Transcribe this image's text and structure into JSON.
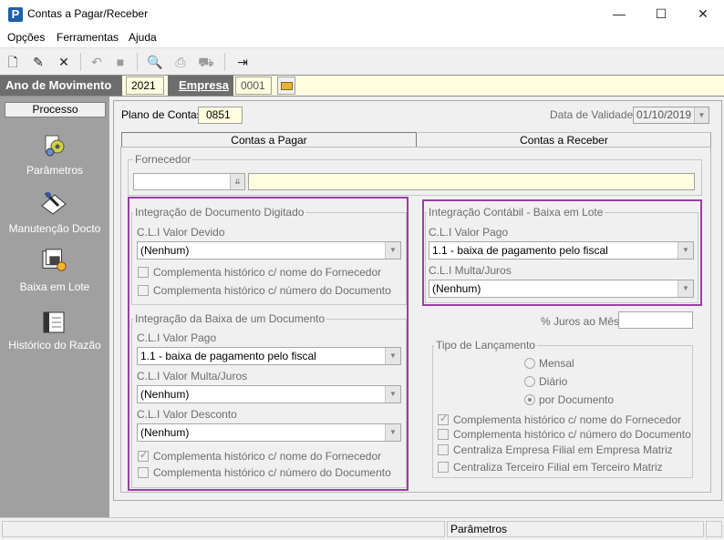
{
  "window": {
    "title": "Contas a Pagar/Receber",
    "app_icon_letter": "P",
    "minimize": "—",
    "maximize": "☐",
    "close": "✕"
  },
  "menu": [
    "Opções",
    "Ferramentas",
    "Ajuda"
  ],
  "toolbar": {
    "icons": [
      "new-document-icon",
      "edit-document-icon",
      "delete-icon",
      "undo-icon",
      "stop-icon",
      "print-preview-icon",
      "print-icon",
      "truck-icon",
      "exit-icon"
    ]
  },
  "yearbar": {
    "ano_label": "Ano de Movimento",
    "ano_value": "2021",
    "empresa_label": "Empresa",
    "empresa_value": "0001",
    "folder_icon": "folder-open-icon"
  },
  "sidebar": {
    "header": "Processo",
    "items": [
      {
        "label": "Parâmetros",
        "icon": "settings-gears-icon"
      },
      {
        "label": "Manutenção Docto",
        "icon": "document-edit-icon"
      },
      {
        "label": "Baixa em Lote",
        "icon": "batch-process-icon"
      },
      {
        "label": "Histórico do Razão",
        "icon": "ledger-book-icon"
      }
    ]
  },
  "main": {
    "plano_label": "Plano de Contas",
    "plano_value": "0851",
    "validade_label": "Data de Validade",
    "validade_value": "01/10/2019",
    "tabs": [
      "Contas a Pagar",
      "Contas a Receber"
    ],
    "fornecedor_title": "Fornecedor",
    "left": {
      "group1_title": "Integração de Documento Digitado",
      "cli_valor_devido_label": "C.L.I Valor Devido",
      "cli_valor_devido_value": "(Nenhum)",
      "chk1_label": "Complementa histórico c/ nome do Fornecedor",
      "chk2_label": "Complementa histórico c/ número do Documento",
      "group2_title": "Integração da Baixa de um Documento",
      "cli_valor_pago_label": "C.L.I Valor Pago",
      "cli_valor_pago_value": "1.1 - baixa de pagamento pelo fiscal",
      "cli_multa_label": "C.L.I Valor Multa/Juros",
      "cli_multa_value": "(Nenhum)",
      "cli_desconto_label": "C.L.I Valor Desconto",
      "cli_desconto_value": "(Nenhum)",
      "chk3_label": "Complementa histórico c/ nome do Fornecedor",
      "chk3_checked": true,
      "chk4_label": "Complementa histórico c/ número do Documento"
    },
    "right": {
      "group_title": "Integração Contábil - Baixa em Lote",
      "cli_valor_pago_label": "C.L.I Valor Pago",
      "cli_valor_pago_value": "1.1 - baixa de pagamento pelo fiscal",
      "cli_multa_label": "C.L.I Multa/Juros",
      "cli_multa_value": "(Nenhum)",
      "juros_label": "% Juros ao Mês",
      "tipo_title": "Tipo de Lançamento",
      "radio_mensal": "Mensal",
      "radio_diario": "Diário",
      "radio_documento": "por Documento",
      "chk1_label": "Complementa histórico c/ nome do Fornecedor",
      "chk1_checked": true,
      "chk2_label": "Complementa histórico c/ número do Documento",
      "chk3_label": "Centraliza Empresa Filial em Empresa Matriz",
      "chk4_label": "Centraliza Terceiro Filial em Terceiro Matriz"
    }
  },
  "status": {
    "pane2": "Parâmetros"
  },
  "colors": {
    "highlight": "#9b3fa3",
    "sidebar_bg": "#a0a0a0",
    "yellow_field": "#fffee0"
  }
}
